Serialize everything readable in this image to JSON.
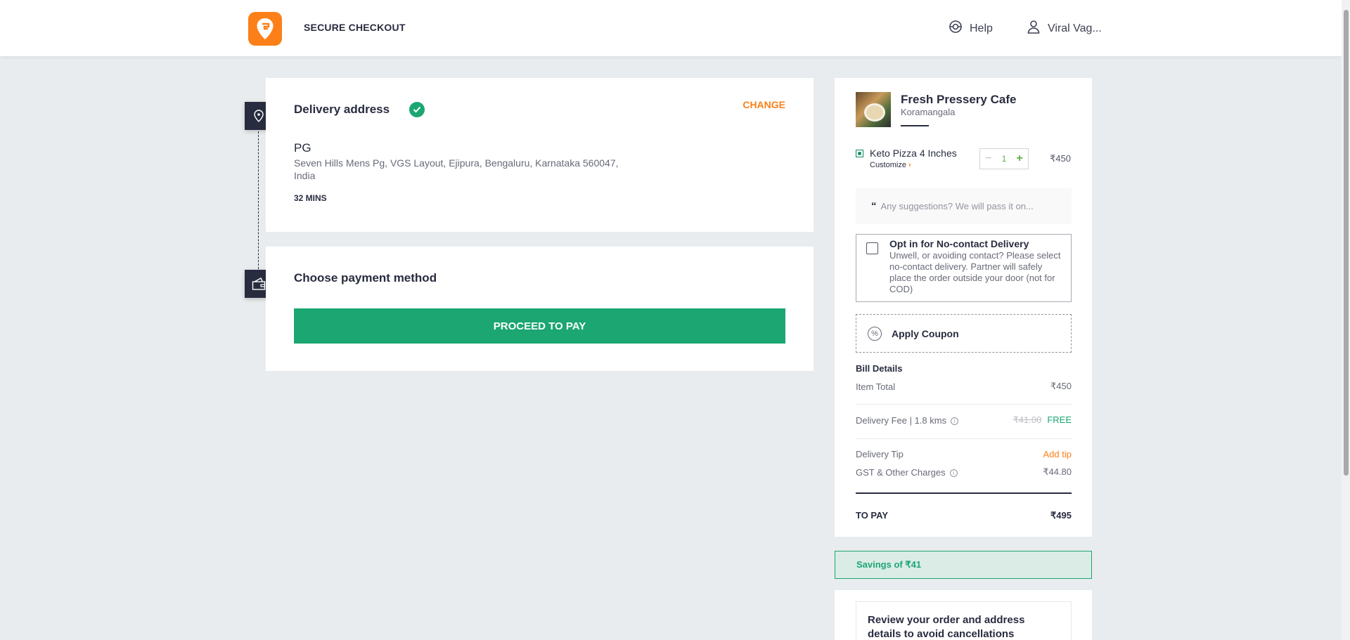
{
  "header": {
    "title": "SECURE CHECKOUT",
    "help_label": "Help",
    "user_name": "Viral Vag..."
  },
  "delivery": {
    "title": "Delivery address",
    "change_label": "CHANGE",
    "address_label": "PG",
    "address_text": "Seven Hills Mens Pg, VGS Layout, Ejipura, Bengaluru, Karnataka 560047, India",
    "eta": "32 MINS"
  },
  "payment": {
    "title": "Choose payment method",
    "proceed_label": "PROCEED TO PAY"
  },
  "cart": {
    "restaurant_name": "Fresh Pressery Cafe",
    "restaurant_area": "Koramangala",
    "item": {
      "name": "Keto Pizza 4 Inches",
      "customize_label": "Customize",
      "quantity": "1",
      "price": "₹450"
    },
    "suggestions_placeholder": "Any suggestions? We will pass it on...",
    "no_contact": {
      "title": "Opt in for No-contact Delivery",
      "description": "Unwell, or avoiding contact? Please select no-contact delivery. Partner will safely place the order outside your door (not for COD)"
    },
    "coupon_label": "Apply Coupon",
    "bill": {
      "title": "Bill Details",
      "item_total_label": "Item Total",
      "item_total_value": "₹450",
      "delivery_fee_label": "Delivery Fee | 1.8 kms",
      "delivery_fee_original": "₹41.00",
      "delivery_fee_value": "FREE",
      "tip_label": "Delivery Tip",
      "tip_action": "Add tip",
      "gst_label": "GST & Other Charges",
      "gst_value": "₹44.80",
      "to_pay_label": "TO PAY",
      "to_pay_value": "₹495"
    },
    "savings": "Savings of ₹41",
    "review_notice": "Review your order and address details to avoid cancellations"
  },
  "colors": {
    "accent": "#fc8019",
    "success": "#1ba672",
    "dark": "#282c3f"
  }
}
